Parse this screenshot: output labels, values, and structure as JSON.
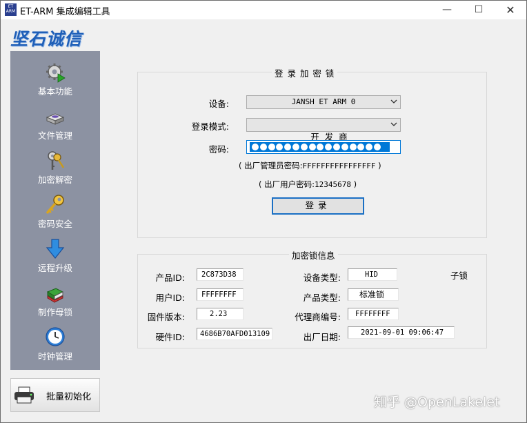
{
  "window": {
    "icon_text_top": "ET",
    "icon_text_bottom": "ARM",
    "title": "ET-ARM 集成编辑工具",
    "minimize": "—",
    "maximize": "☐",
    "close": "✕"
  },
  "brand": {
    "logo_text": "坚石诚信"
  },
  "sidebar": {
    "items": [
      {
        "label": "基本功能",
        "icon": "gear-play-icon"
      },
      {
        "label": "文件管理",
        "icon": "disk-icon"
      },
      {
        "label": "加密解密",
        "icon": "keys-icon"
      },
      {
        "label": "密码安全",
        "icon": "key-icon"
      },
      {
        "label": "远程升级",
        "icon": "down-arrow-icon"
      },
      {
        "label": "制作母锁",
        "icon": "book-icon"
      },
      {
        "label": "时钟管理",
        "icon": "clock-icon"
      }
    ],
    "batch_button": {
      "label": "批量初始化",
      "icon": "printer-icon"
    }
  },
  "login_group": {
    "title": "登 录 加 密 锁",
    "device_label": "设备:",
    "device_value": "JANSH ET ARM 0",
    "mode_label": "登录模式:",
    "mode_value": "开  发  商",
    "password_label": "密码:",
    "password_dot_count": 16,
    "admin_hint_prefix": "( 出厂管理员密码:",
    "admin_hint_value": "FFFFFFFFFFFFFFFF",
    "admin_hint_suffix": " )",
    "user_hint_prefix": "( 出厂用户密码:",
    "user_hint_value": "12345678",
    "user_hint_suffix": " )",
    "login_button": "登录"
  },
  "info_group": {
    "title": "加密锁信息",
    "product_id_label": "产品ID:",
    "product_id": "2C873D38",
    "user_id_label": "用户ID:",
    "user_id": "FFFFFFFF",
    "firmware_label": "固件版本:",
    "firmware": "2.23",
    "hardware_id_label": "硬件ID:",
    "hardware_id": "4686B70AFD013109",
    "device_type_label": "设备类型:",
    "device_type": "HID",
    "sub_lock": "子锁",
    "product_type_label": "产品类型:",
    "product_type": "标准锁",
    "agent_no_label": "代理商编号:",
    "agent_no": "FFFFFFFF",
    "factory_date_label": "出厂日期:",
    "factory_date": "2021-09-01 09:06:47"
  },
  "watermark": "知乎 @OpenLakelet",
  "colors": {
    "sidebar": "#8c92a2",
    "accent": "#0078d7",
    "logo": "#1f5fb8"
  }
}
